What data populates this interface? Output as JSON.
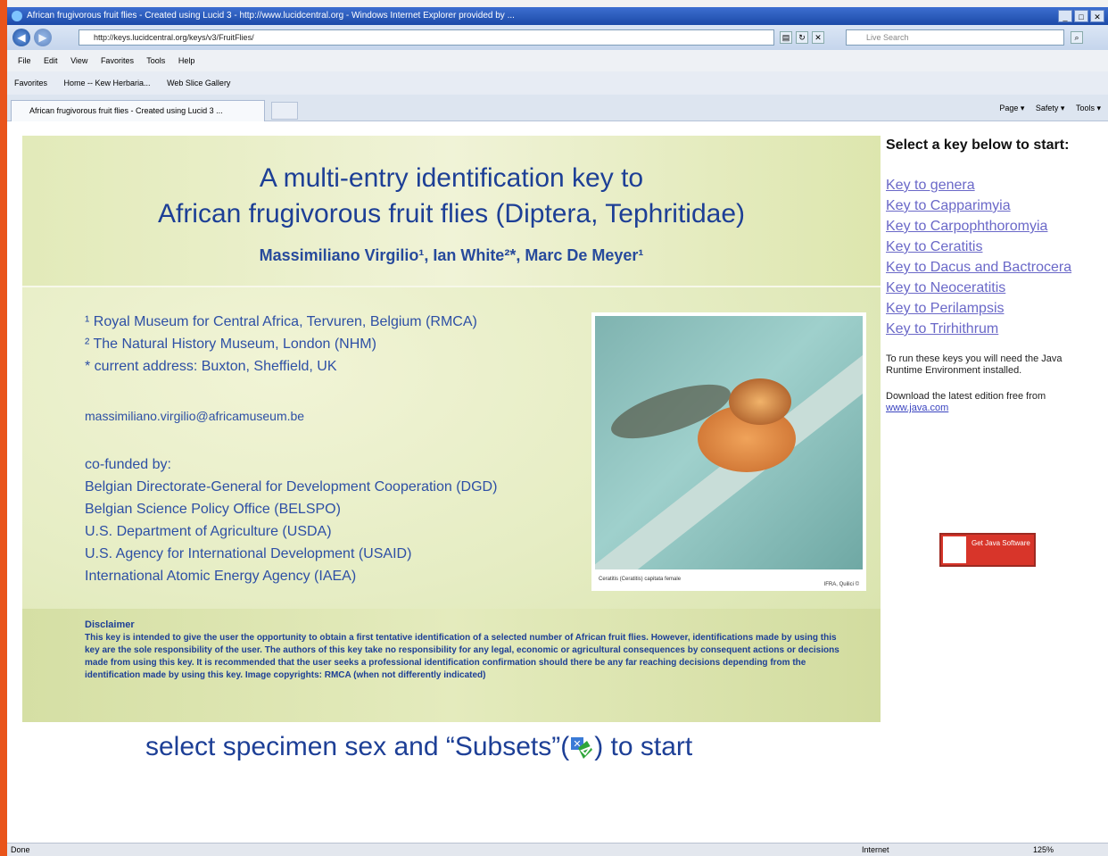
{
  "browser": {
    "window_title": "African frugivorous fruit flies - Created using Lucid 3 - http://www.lucidcentral.org - Windows Internet Explorer provided by ...",
    "url": "http://keys.lucidcentral.org/keys/v3/FruitFlies/",
    "search_placeholder": "Live Search",
    "menu": [
      "File",
      "Edit",
      "View",
      "Favorites",
      "Tools",
      "Help"
    ],
    "favorites_bar": [
      "Favorites",
      "Home -- Kew Herbaria...",
      "Web Slice Gallery"
    ],
    "tab_title": "African frugivorous fruit flies - Created using Lucid 3 ...",
    "command_bar": [
      "Page ▾",
      "Safety ▾",
      "Tools ▾"
    ],
    "status": {
      "left": "Done",
      "zone": "Internet",
      "zoom": "125%"
    }
  },
  "page": {
    "title_line1": "A multi-entry identification key to",
    "title_line2": "African frugivorous fruit flies (Diptera, Tephritidae)",
    "authors": "Massimiliano Virgilio¹, Ian White²*, Marc De Meyer¹",
    "affiliations": [
      "¹ Royal Museum for Central Africa, Tervuren, Belgium (RMCA)",
      "² The Natural History Museum, London (NHM)",
      "* current  address: Buxton, Sheffield, UK"
    ],
    "email": "massimiliano.virgilio@africamuseum.be",
    "cofunded_label": "co-funded by:",
    "funders": [
      "Belgian Directorate-General for Development Cooperation (DGD)",
      "Belgian Science Policy Office (BELSPO)",
      "U.S. Department of Agriculture (USDA)",
      "U.S. Agency for International Development (USAID)",
      "International Atomic Energy Agency (IAEA)"
    ],
    "photo_caption": "Ceratitis (Ceratitis) capitata female",
    "photo_credit": "IFRA, Quilici ©",
    "disclaimer_title": "Disclaimer",
    "disclaimer_text": "This key is intended to give the user the opportunity to obtain a first tentative identification of a selected number of African fruit flies. However, identifications made by using this key are the sole responsibility of the user. The authors of this key take no responsibility for any legal, economic or agricultural consequences by consequent actions or decisions made from using this key. It is recommended that the user seeks a professional identification confirmation should there be any far reaching decisions depending from the identification made by using this key. Image copyrights: RMCA (when not differently indicated)",
    "start_before": "select specimen sex and “Subsets”(",
    "start_after": ") to start"
  },
  "sidebar": {
    "title": "Select a key below to start:",
    "keys": [
      "Key to genera",
      "Key to Capparimyia",
      "Key to Carpophthoromyia",
      "Key to Ceratitis",
      "Key to Dacus and Bactrocera",
      "Key to Neoceratitis",
      "Key to Perilampsis",
      "Key to Trirhithrum"
    ],
    "java_note": "To run these keys you will need the Java Runtime Environment installed.",
    "download_note": "Download the latest edition free from",
    "java_link": "www.java.com",
    "java_button": "Get Java Software"
  }
}
